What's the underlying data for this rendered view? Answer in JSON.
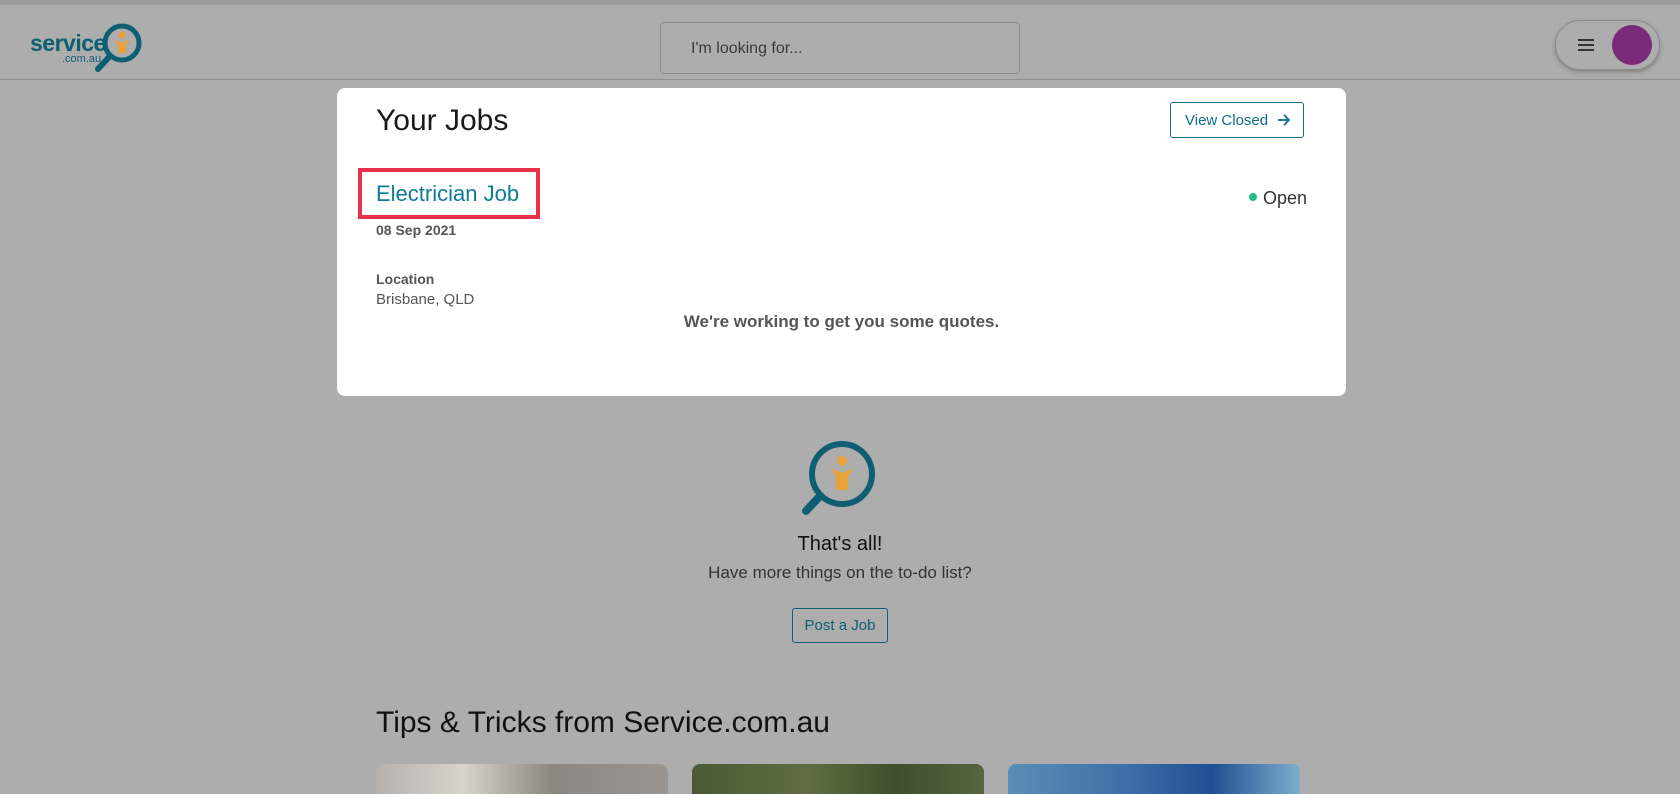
{
  "header": {
    "logo_text": "service",
    "logo_sub": ".com.au",
    "search_placeholder": "I'm looking for...",
    "avatar_color": "#7a2a78"
  },
  "jobs": {
    "title": "Your Jobs",
    "view_closed_label": "View Closed",
    "job": {
      "name": "Electrician Job",
      "date": "08 Sep 2021",
      "location_label": "Location",
      "location_value": "Brisbane, QLD",
      "status": "Open",
      "status_color": "#1cbf8c"
    },
    "quotes_message": "We're working to get you some quotes."
  },
  "end": {
    "title": "That's all!",
    "subtitle": "Have more things on the to-do list?",
    "post_job_label": "Post a Job"
  },
  "tips": {
    "title": "Tips & Tricks from Service.com.au"
  },
  "colors": {
    "brand_teal": "#0e5f73",
    "brand_orange": "#e8a23a",
    "highlight_red": "#e8324a"
  }
}
